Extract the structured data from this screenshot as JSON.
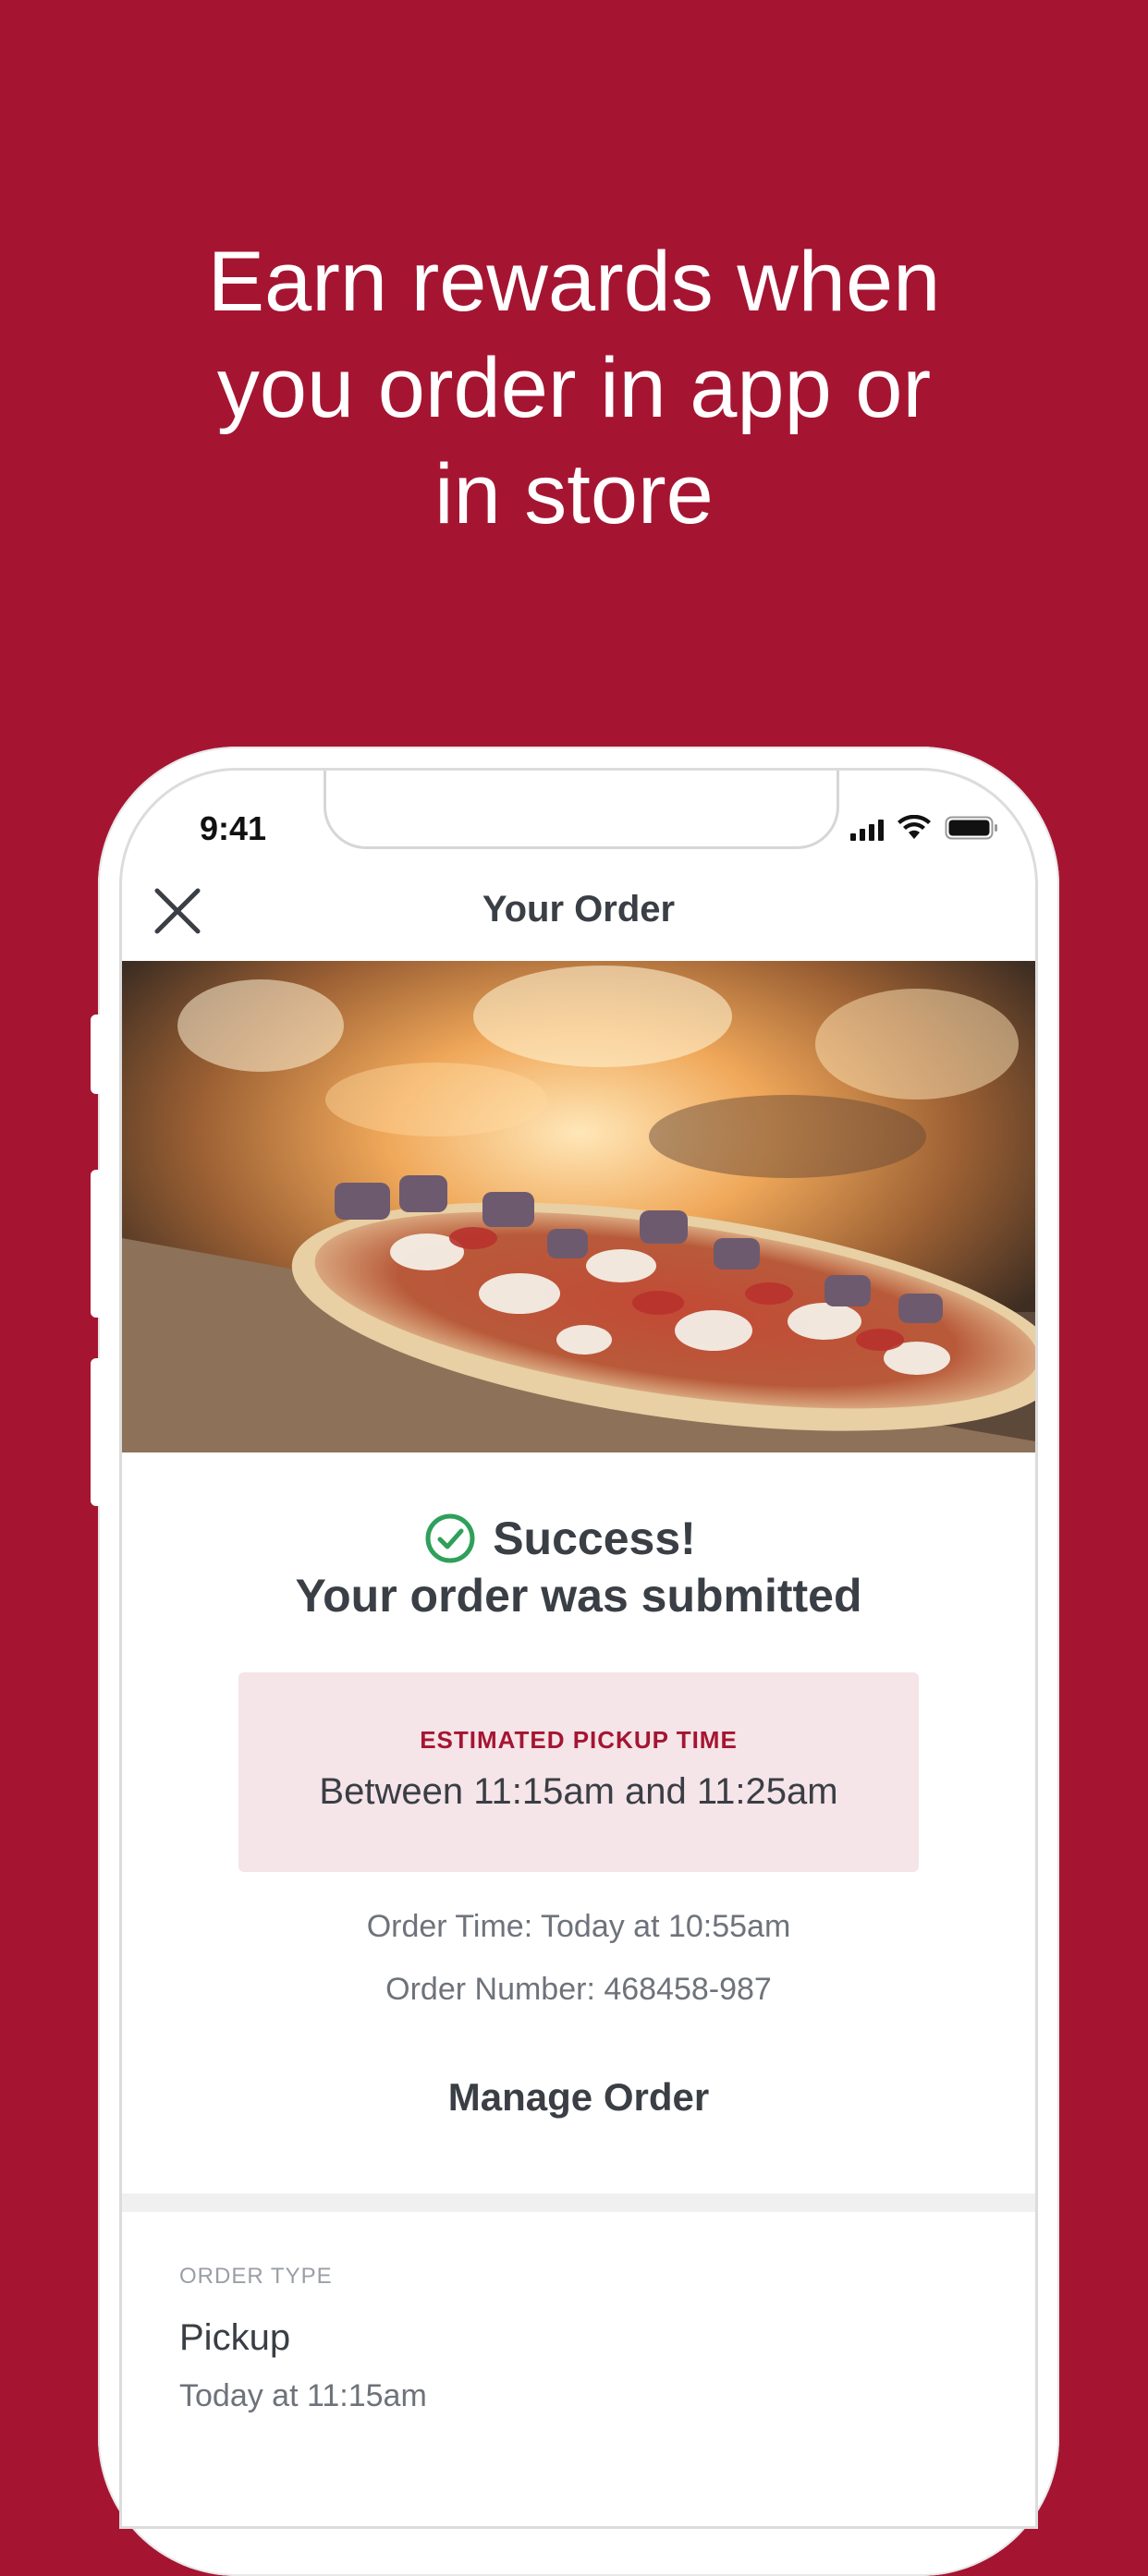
{
  "headline": {
    "line1": "Earn rewards when",
    "line2": "you order in app or",
    "line3": "in store"
  },
  "status_bar": {
    "time": "9:41"
  },
  "nav": {
    "title": "Your Order"
  },
  "confirmation": {
    "success_label": "Success!",
    "submitted_label": "Your order was submitted"
  },
  "pickup": {
    "label": "ESTIMATED PICKUP TIME",
    "value": "Between 11:15am and 11:25am"
  },
  "details": {
    "order_time": "Order Time: Today at 10:55am",
    "order_number": "Order Number: 468458-987"
  },
  "actions": {
    "manage_order": "Manage Order"
  },
  "order_type": {
    "label": "ORDER TYPE",
    "value": "Pickup",
    "time": "Today at 11:15am"
  },
  "colors": {
    "brand": "#a51532",
    "success": "#2fa05a",
    "pickup_box": "#f5e4e8",
    "text_dark": "#3a3e45",
    "text_muted": "#6e737b"
  }
}
